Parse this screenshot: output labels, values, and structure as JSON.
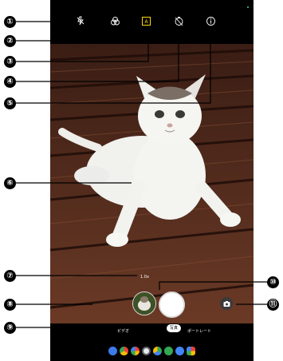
{
  "camera": {
    "zoom_label": "1.0x",
    "modes": {
      "video": "ビデオ",
      "photo": "写真",
      "portrait": "ポートレート"
    },
    "selected_mode": "photo"
  },
  "callouts": [
    "①",
    "②",
    "③",
    "④",
    "⑤",
    "⑥",
    "⑦",
    "⑧",
    "⑨",
    "⑩",
    "⑪"
  ],
  "top_icons": [
    "flash-off-icon",
    "filter-icon",
    "auto-frame-icon",
    "timer-icon",
    "info-icon"
  ],
  "dock_apps": [
    "messages-icon",
    "chrome-icon",
    "photos-icon",
    "camera-app-icon",
    "play-store-icon",
    "maps-icon",
    "settings-icon",
    "apps-icon"
  ],
  "colors": {
    "screen_bg": "#000000",
    "accent_frame": "#ffd60a"
  }
}
